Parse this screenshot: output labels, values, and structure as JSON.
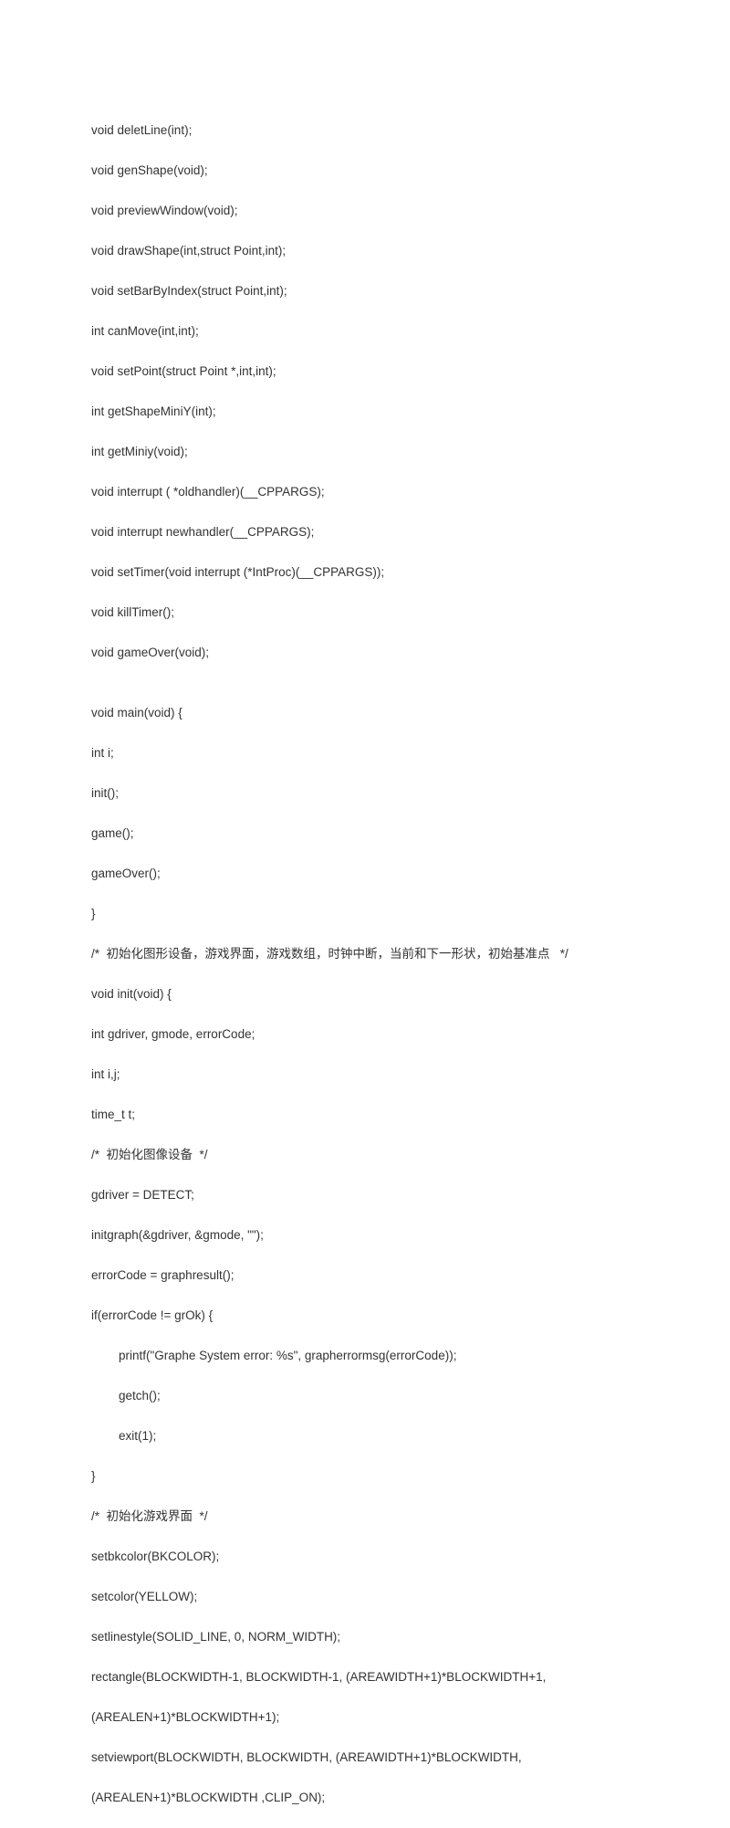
{
  "code": {
    "l1": "void deletLine(int);",
    "l2": "void genShape(void);",
    "l3": "void previewWindow(void);",
    "l4": "void drawShape(int,struct Point,int);",
    "l5": "void setBarByIndex(struct Point,int);",
    "l6": "int canMove(int,int);",
    "l7": "void setPoint(struct Point *,int,int);",
    "l8": "int getShapeMiniY(int);",
    "l9": "int getMiniy(void);",
    "l10": "void interrupt ( *oldhandler)(__CPPARGS);",
    "l11": "void interrupt newhandler(__CPPARGS);",
    "l12": "void setTimer(void interrupt (*IntProc)(__CPPARGS));",
    "l13": "void killTimer();",
    "l14": "void gameOver(void);",
    "l15": "",
    "l16": "void main(void) {",
    "l17": "int i;",
    "l18": "init();",
    "l19": "game();",
    "l20": "gameOver();",
    "l21": "}",
    "l22": "/*  初始化图形设备，游戏界面，游戏数组，时钟中断，当前和下一形状，初始基准点   */",
    "l23": "void init(void) {",
    "l24": "int gdriver, gmode, errorCode;",
    "l25": "int i,j;",
    "l26": "time_t t;",
    "l27": "/*  初始化图像设备  */",
    "l28": "gdriver = DETECT;",
    "l29": "initgraph(&gdriver, &gmode, \"\");",
    "l30": "errorCode = graphresult();",
    "l31": "if(errorCode != grOk) {",
    "l32": "printf(\"Graphe System error: %s\", grapherrormsg(errorCode));",
    "l33": "getch();",
    "l34": "exit(1);",
    "l35": "}",
    "l36": "/*  初始化游戏界面  */",
    "l37": "setbkcolor(BKCOLOR);",
    "l38": "setcolor(YELLOW);",
    "l39": "setlinestyle(SOLID_LINE, 0, NORM_WIDTH);",
    "l40": "rectangle(BLOCKWIDTH-1, BLOCKWIDTH-1, (AREAWIDTH+1)*BLOCKWIDTH+1,",
    "l41": "(AREALEN+1)*BLOCKWIDTH+1);",
    "l42": "setviewport(BLOCKWIDTH, BLOCKWIDTH, (AREAWIDTH+1)*BLOCKWIDTH,",
    "l43": "(AREALEN+1)*BLOCKWIDTH ,CLIP_ON);"
  }
}
